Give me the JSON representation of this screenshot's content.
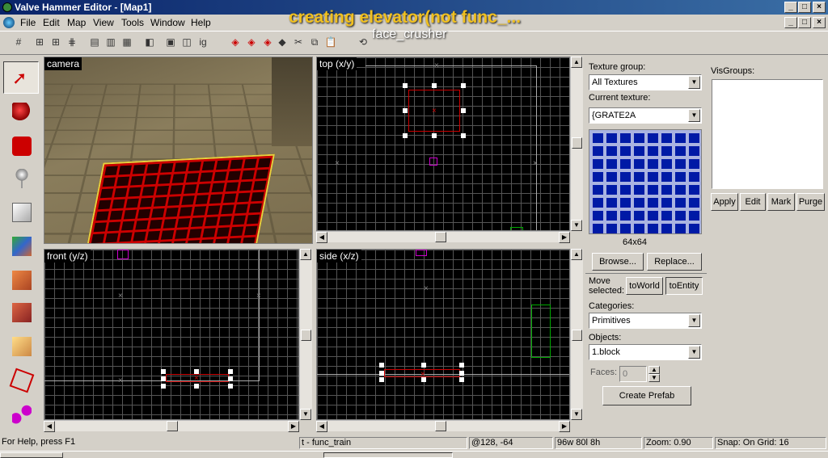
{
  "window": {
    "title": "Valve Hammer Editor - [Map1]"
  },
  "overlay": {
    "caption": "creating elevator(not func_...",
    "subcaption": "face_crusher"
  },
  "menu": [
    "File",
    "Edit",
    "Map",
    "View",
    "Tools",
    "Window",
    "Help"
  ],
  "views": {
    "camera": "camera",
    "top": "top (x/y)",
    "front": "front (y/z)",
    "side": "side (x/z)"
  },
  "texture": {
    "group_label": "Texture group:",
    "group_value": "All Textures",
    "current_label": "Current texture:",
    "current_value": "{GRATE2A",
    "size": "64x64",
    "browse": "Browse...",
    "replace": "Replace..."
  },
  "move": {
    "label": "Move selected:",
    "to_world": "toWorld",
    "to_entity": "toEntity"
  },
  "categories": {
    "label": "Categories:",
    "value": "Primitives"
  },
  "objects": {
    "label": "Objects:",
    "value": "1.block"
  },
  "faces": {
    "label": "Faces:",
    "value": "0"
  },
  "create_prefab": "Create Prefab",
  "visgroups": {
    "label": "VisGroups:",
    "apply": "Apply",
    "edit": "Edit",
    "mark": "Mark",
    "purge": "Purge"
  },
  "status": {
    "help": "For Help, press F1",
    "entity": "t - func_train",
    "coords": "@128, -64",
    "size": "96w 80l 8h",
    "zoom": "Zoom: 0.90",
    "snap": "Snap: On Grid: 16"
  },
  "colors": {
    "selection": "#c00000",
    "view_bg": "#000000",
    "title_bar": "#0a246a",
    "caption": "#f0c020"
  },
  "tool_icons": [
    "pointer-icon",
    "magnify-icon",
    "camera-icon",
    "entity-icon",
    "block-icon",
    "texture-icon",
    "apply-texture-icon",
    "decal-icon",
    "overlay-icon",
    "clip-icon",
    "vertex-icon"
  ]
}
